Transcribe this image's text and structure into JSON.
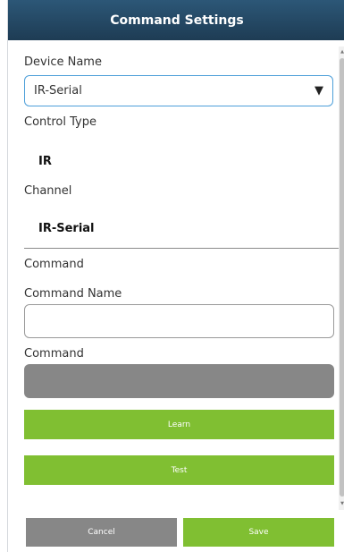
{
  "header": {
    "title": "Command Settings"
  },
  "device": {
    "label": "Device Name",
    "selected": "IR-Serial"
  },
  "control_type": {
    "label": "Control Type",
    "value": "IR"
  },
  "channel": {
    "label": "Channel",
    "value": "IR-Serial"
  },
  "command_section": {
    "label": "Command"
  },
  "command_name": {
    "label": "Command Name",
    "value": "",
    "placeholder": ""
  },
  "command": {
    "label": "Command",
    "value": ""
  },
  "buttons": {
    "learn": "Learn",
    "test": "Test",
    "cancel": "Cancel",
    "save": "Save"
  },
  "colors": {
    "header": "#1e3c54",
    "accent_green": "#80bf32",
    "neutral_gray": "#878787",
    "focus_blue": "#4d9fd9"
  }
}
